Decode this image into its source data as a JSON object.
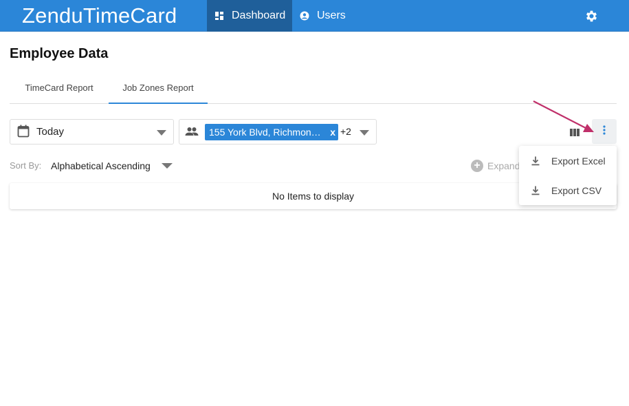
{
  "app": {
    "title": "ZenduTimeCard"
  },
  "nav": {
    "items": [
      {
        "label": "Dashboard",
        "icon": "dashboard-icon",
        "active": true
      },
      {
        "label": "Users",
        "icon": "user-circle-icon",
        "active": false
      }
    ],
    "settings_icon": "gear-icon"
  },
  "page": {
    "title": "Employee Data"
  },
  "tabs": [
    {
      "label": "TimeCard Report",
      "active": false
    },
    {
      "label": "Job Zones Report",
      "active": true
    }
  ],
  "filters": {
    "date": {
      "value": "Today",
      "icon": "calendar-icon"
    },
    "zones": {
      "icon": "people-icon",
      "chip": "155 York Blvd, Richmond Hill",
      "chip_remove": "x",
      "more_count": "+2"
    }
  },
  "toolbar": {
    "columns_icon": "columns-icon",
    "more_icon": "more-vertical-icon"
  },
  "sort": {
    "label": "Sort By:",
    "value": "Alphabetical Ascending"
  },
  "expand": {
    "label": "Expand"
  },
  "list": {
    "empty_message": "No Items to display"
  },
  "menu": {
    "items": [
      {
        "label": "Export Excel",
        "icon": "download-icon"
      },
      {
        "label": "Export CSV",
        "icon": "download-icon"
      }
    ]
  },
  "colors": {
    "brand": "#2b86d8",
    "nav_active": "#1f5f9a",
    "annotation_arrow": "#c0306a"
  }
}
